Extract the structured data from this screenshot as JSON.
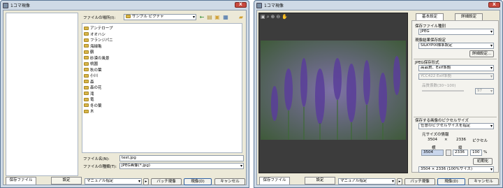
{
  "left": {
    "title": "1コマ現像",
    "close": "X",
    "location_label": "ファイルの場所(I):",
    "location_value": "サンプル ピクチャ",
    "folders": [
      "アンテロープ",
      "オオハシ",
      "フランジパニ",
      "海緑亀",
      "鶴",
      "砂漠の風景",
      "桃園",
      "秋の葉",
      "小川",
      "森",
      "森の花",
      "滝",
      "竜",
      "冬の葉",
      "木"
    ],
    "filename_label": "ファイル名(N):",
    "filename_value": "test.jpg",
    "filetype_label": "ファイルの種類(T):",
    "filetype_value": "JPEG画像(*.jpg)",
    "tab_save": "保存ファイル",
    "tab_settings": "設定",
    "preset": "マニュアル指定",
    "batch": "バッチ現像",
    "develop": "現像(D)",
    "cancel": "キャンセル"
  },
  "right": {
    "title": "1コマ現像",
    "close": "X",
    "tab_basic": "基本設定",
    "tab_detail": "詳細設定",
    "filetype_label": "保存ファイル種別",
    "filetype_value": "JPEG",
    "result_label": "現像結果保存設定",
    "result_value": "SILKYPIX標準設定",
    "detail_btn": "詳細設定...",
    "jpeg_label": "JPEG保存形式",
    "jpeg_quality": "高品質、Exif準拠",
    "jpeg_color": "YCC422 Exif準拠",
    "quality_label": "品質係数(30~100)",
    "quality_value": "97",
    "size_label": "保存する画像のピクセルサイズ",
    "size_mode": "任意のピクセルサイズを指定",
    "orig_label": "元サイズの情報",
    "orig_w": "3504",
    "orig_x": "×",
    "orig_h": "2336",
    "orig_unit": "ピクセル",
    "w_label": "横",
    "h_label": "縦",
    "w_value": "3504",
    "h_value": "2336",
    "pct_value": "100",
    "pct_unit": "%",
    "init_btn": "初期化",
    "size_preset": "3504 × 2336 (100%サイズ)",
    "tab_save": "保存ファイル",
    "tab_settings": "設定",
    "preset": "マニュアル指定",
    "batch": "バッチ現像",
    "develop": "現像(D)",
    "cancel": "キャンセル"
  }
}
